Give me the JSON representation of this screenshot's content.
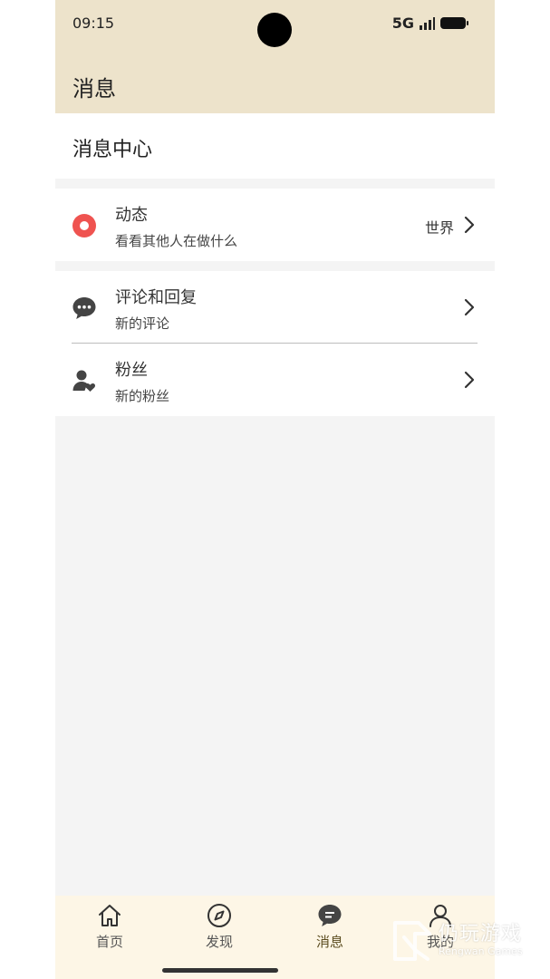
{
  "status": {
    "time": "09:15",
    "network": "5G"
  },
  "header": {
    "title": "消息"
  },
  "section": {
    "title": "消息中心"
  },
  "rows": [
    {
      "title": "动态",
      "subtitle": "看看其他人在做什么",
      "right_text": "世界",
      "icon": "record-icon",
      "icon_color": "#ef5350"
    },
    {
      "title": "评论和回复",
      "subtitle": "新的评论",
      "icon": "comment-icon"
    },
    {
      "title": "粉丝",
      "subtitle": "新的粉丝",
      "icon": "fans-icon"
    }
  ],
  "tabbar": {
    "tabs": [
      {
        "label": "首页",
        "icon": "home-icon"
      },
      {
        "label": "发现",
        "icon": "compass-icon"
      },
      {
        "label": "消息",
        "icon": "message-icon",
        "active": true
      },
      {
        "label": "我的",
        "icon": "profile-icon"
      }
    ]
  },
  "watermark": {
    "text": "仍玩游戏",
    "sub": "Rengwan Games"
  },
  "colors": {
    "header_bg": "#ede3cb",
    "tabbar_bg": "#fdf6e6",
    "accent_red": "#ef5350",
    "active_tab": "#5b4c1f"
  }
}
